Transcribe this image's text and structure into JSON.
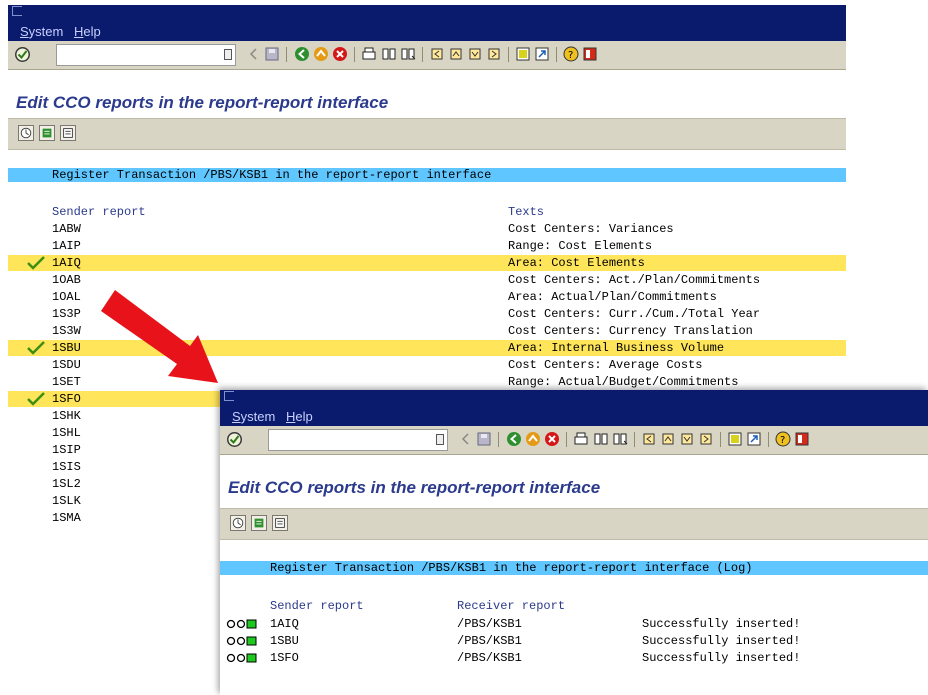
{
  "menu": {
    "system": "System",
    "help": "Help"
  },
  "page_title": "Edit CCO reports in the report-report interface",
  "window1": {
    "banner": "Register Transaction /PBS/KSB1 in the report-report interface",
    "col_sender": "Sender report",
    "col_texts": "Texts",
    "rows": [
      {
        "code": "1ABW",
        "text": "Cost Centers: Variances"
      },
      {
        "code": "1AIP",
        "text": "Range: Cost Elements"
      },
      {
        "code": "1AIQ",
        "text": "Area: Cost Elements"
      },
      {
        "code": "1OAB",
        "text": "Cost Centers: Act./Plan/Commitments"
      },
      {
        "code": "1OAL",
        "text": "Area: Actual/Plan/Commitments"
      },
      {
        "code": "1S3P",
        "text": "Cost Centers: Curr./Cum./Total Year"
      },
      {
        "code": "1S3W",
        "text": "Cost Centers: Currency Translation"
      },
      {
        "code": "1SBU",
        "text": "Area: Internal Business Volume"
      },
      {
        "code": "1SDU",
        "text": "Cost Centers: Average Costs"
      },
      {
        "code": "1SET",
        "text": "Range: Actual/Budget/Commitments"
      },
      {
        "code": "1SFO",
        "text": ""
      },
      {
        "code": "1SHK",
        "text": ""
      },
      {
        "code": "1SHL",
        "text": ""
      },
      {
        "code": "1SIP",
        "text": ""
      },
      {
        "code": "1SIS",
        "text": ""
      },
      {
        "code": "1SL2",
        "text": ""
      },
      {
        "code": "1SLK",
        "text": ""
      },
      {
        "code": "1SMA",
        "text": ""
      }
    ]
  },
  "window2": {
    "banner": "Register Transaction /PBS/KSB1 in the report-report interface (Log)",
    "col_sender": "Sender report",
    "col_receiver": "Receiver report",
    "rows": [
      {
        "sender": "1AIQ",
        "receiver": "/PBS/KSB1",
        "status": "Successfully inserted!"
      },
      {
        "sender": "1SBU",
        "receiver": "/PBS/KSB1",
        "status": "Successfully inserted!"
      },
      {
        "sender": "1SFO",
        "receiver": "/PBS/KSB1",
        "status": "Successfully inserted!"
      }
    ]
  },
  "colors": {
    "menubar": "#0a1a6c",
    "toolbar": "#d8d5c4",
    "highlight": "#ffe55a",
    "banner": "#5fc6ff",
    "arrow": "#e8121a",
    "title": "#2b3a8c"
  }
}
